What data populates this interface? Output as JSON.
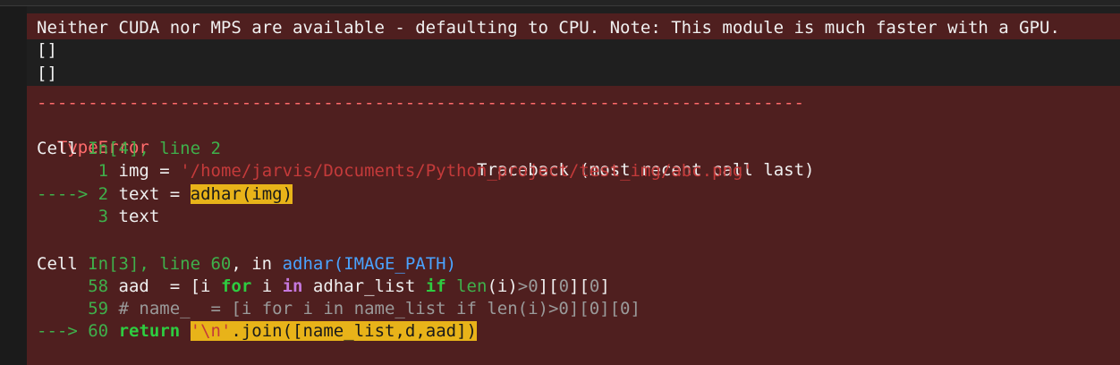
{
  "output": {
    "warning": "Neither CUDA nor MPS are available - defaulting to CPU. Note: This module is much faster with a GPU.",
    "list1": "[]",
    "list2": "[]"
  },
  "traceback": {
    "dashes": "---------------------------------------------------------------------------",
    "error_type": "TypeError",
    "header_right": "Traceback (most recent call last)",
    "frame1": {
      "cell_label": "Cell ",
      "cell_ref": "In[4], line 2",
      "lines": [
        {
          "num": "1",
          "code_pre": "img = ",
          "string": "'/home/jarvis/Documents/Python_project/test_img/abc.png'"
        },
        {
          "arrow": "---->",
          "num": "2",
          "code_pre": "text = ",
          "highlight": "adhar(img)"
        },
        {
          "num": "3",
          "code_pre": "text"
        }
      ]
    },
    "frame2": {
      "cell_label": "Cell ",
      "cell_ref": "In[3], line 60",
      "in_text": ", in ",
      "func": "adhar",
      "args": "(IMAGE_PATH)",
      "line58": {
        "num": "58",
        "p1": "aad  = [i ",
        "kw_for": "for",
        "p2": " i ",
        "kw_in": "in",
        "p3": " adhar_list ",
        "kw_if": "if",
        "p4": " ",
        "len": "len",
        "p5": "(i)",
        "gt": ">",
        "zero1": "0",
        "p6": "][",
        "zero2": "0",
        "p7": "][",
        "zero3": "0",
        "p8": "]"
      },
      "line59": {
        "num": "59",
        "text": "# name_  = [i for i in name_list if len(i)>0][0][0]"
      },
      "line60": {
        "arrow": "--->",
        "num": "60",
        "kw_return": "return",
        "space": " ",
        "str_nl": "'\\n'",
        "join": ".join([name_list,d,aad])"
      }
    }
  }
}
